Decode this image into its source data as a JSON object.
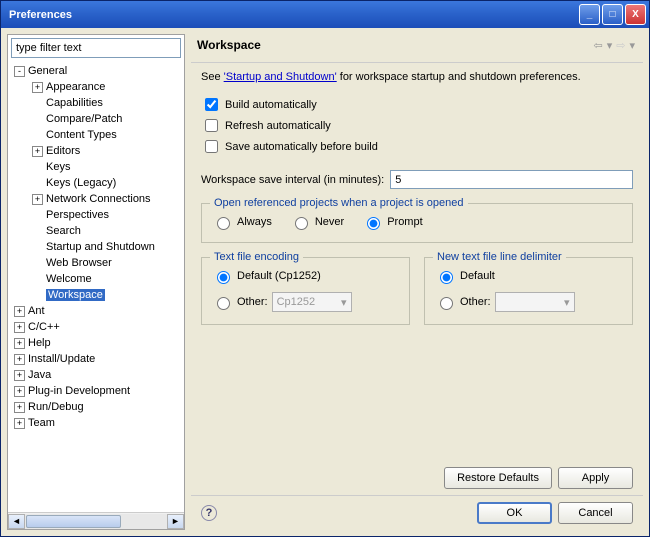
{
  "window": {
    "title": "Preferences"
  },
  "filter": {
    "placeholder": "type filter text"
  },
  "tree": {
    "items": [
      {
        "label": "General",
        "depth": 0,
        "exp": "-"
      },
      {
        "label": "Appearance",
        "depth": 1,
        "exp": "+"
      },
      {
        "label": "Capabilities",
        "depth": 1,
        "exp": ""
      },
      {
        "label": "Compare/Patch",
        "depth": 1,
        "exp": ""
      },
      {
        "label": "Content Types",
        "depth": 1,
        "exp": ""
      },
      {
        "label": "Editors",
        "depth": 1,
        "exp": "+"
      },
      {
        "label": "Keys",
        "depth": 1,
        "exp": ""
      },
      {
        "label": "Keys (Legacy)",
        "depth": 1,
        "exp": ""
      },
      {
        "label": "Network Connections",
        "depth": 1,
        "exp": "+"
      },
      {
        "label": "Perspectives",
        "depth": 1,
        "exp": ""
      },
      {
        "label": "Search",
        "depth": 1,
        "exp": ""
      },
      {
        "label": "Startup and Shutdown",
        "depth": 1,
        "exp": ""
      },
      {
        "label": "Web Browser",
        "depth": 1,
        "exp": ""
      },
      {
        "label": "Welcome",
        "depth": 1,
        "exp": ""
      },
      {
        "label": "Workspace",
        "depth": 1,
        "exp": "",
        "selected": true
      },
      {
        "label": "Ant",
        "depth": 0,
        "exp": "+"
      },
      {
        "label": "C/C++",
        "depth": 0,
        "exp": "+"
      },
      {
        "label": "Help",
        "depth": 0,
        "exp": "+"
      },
      {
        "label": "Install/Update",
        "depth": 0,
        "exp": "+"
      },
      {
        "label": "Java",
        "depth": 0,
        "exp": "+"
      },
      {
        "label": "Plug-in Development",
        "depth": 0,
        "exp": "+"
      },
      {
        "label": "Run/Debug",
        "depth": 0,
        "exp": "+"
      },
      {
        "label": "Team",
        "depth": 0,
        "exp": "+"
      }
    ]
  },
  "page": {
    "title": "Workspace",
    "desc_pre": "See ",
    "desc_link": "'Startup and Shutdown'",
    "desc_post": " for workspace startup and shutdown preferences.",
    "build_auto": "Build automatically",
    "refresh_auto": "Refresh automatically",
    "save_auto": "Save automatically before build",
    "save_interval_label": "Workspace save interval (in minutes):",
    "save_interval_value": "5",
    "open_ref": {
      "legend": "Open referenced projects when a project is opened",
      "always": "Always",
      "never": "Never",
      "prompt": "Prompt"
    },
    "encoding": {
      "legend": "Text file encoding",
      "default": "Default (Cp1252)",
      "other": "Other:",
      "other_val": "Cp1252"
    },
    "delimiter": {
      "legend": "New text file line delimiter",
      "default": "Default",
      "other": "Other:"
    }
  },
  "buttons": {
    "restore": "Restore Defaults",
    "apply": "Apply",
    "ok": "OK",
    "cancel": "Cancel"
  }
}
